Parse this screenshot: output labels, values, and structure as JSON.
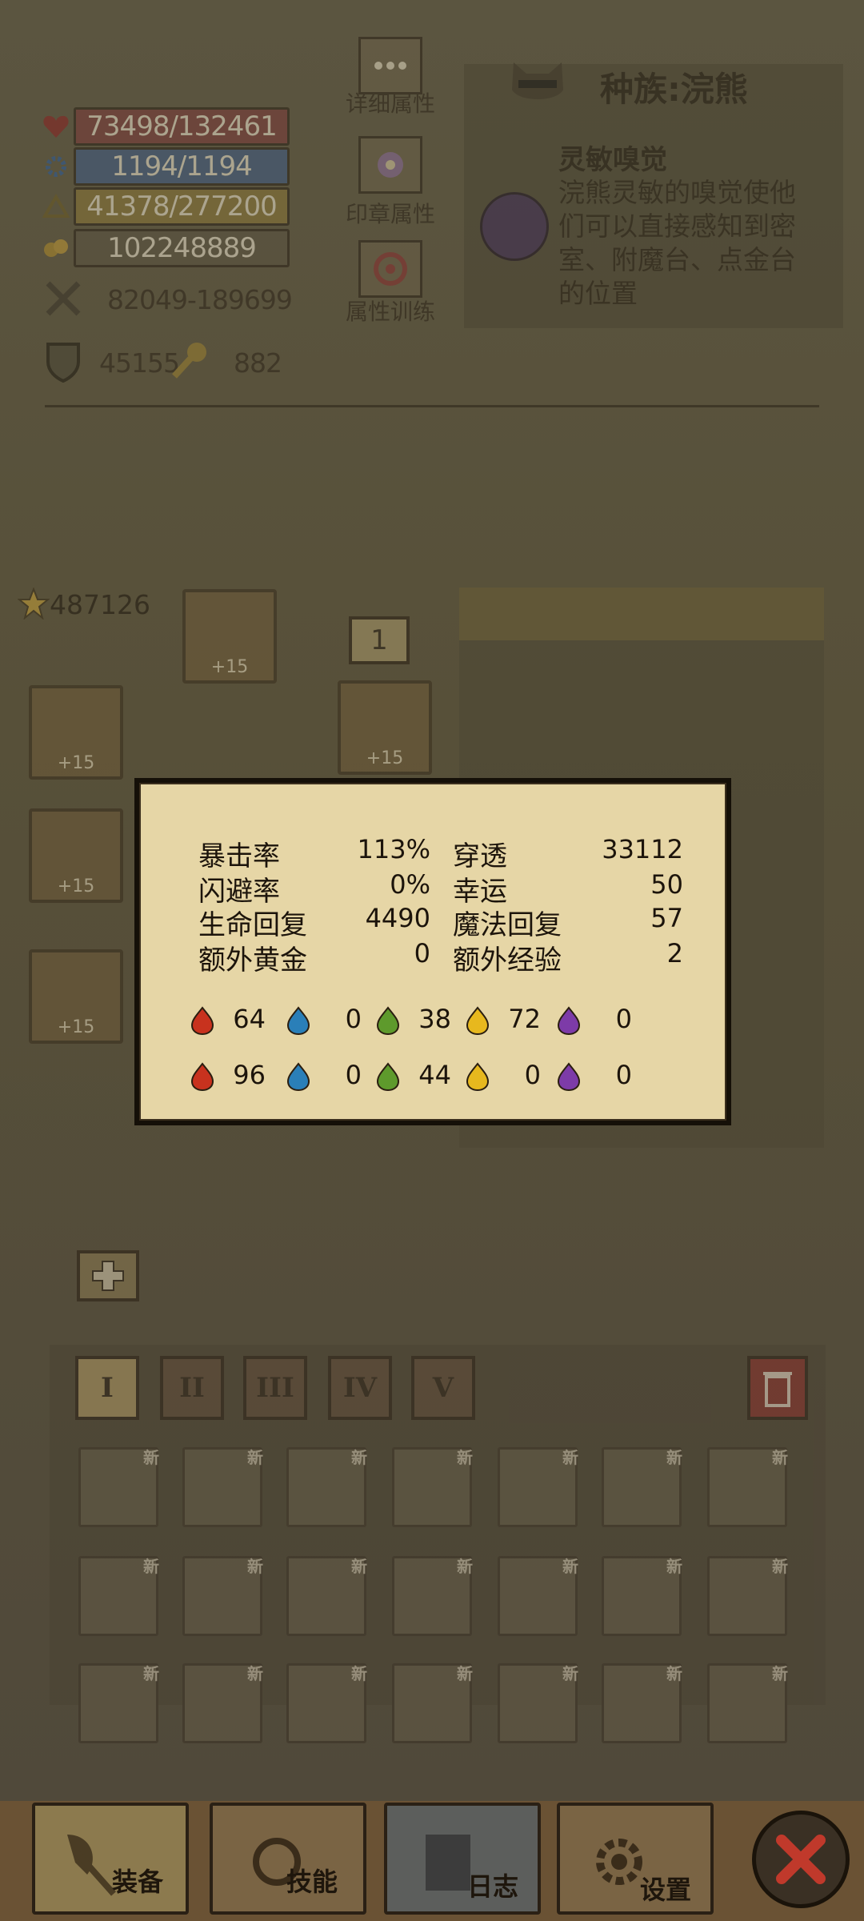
{
  "stats": {
    "hp": "73498/132461",
    "mp": "1194/1194",
    "xp": "41378/277200",
    "gold": "102248889",
    "attack": "82049-189699",
    "defense": "45155",
    "keys": "882"
  },
  "side_buttons": {
    "detail": "详细属性",
    "seal": "印章属性",
    "training": "属性训练"
  },
  "race": {
    "title": "种族:浣熊",
    "skill_name": "灵敏嗅觉",
    "skill_desc_lines": [
      "浣熊灵敏的嗅觉使他",
      "们可以直接感知到密",
      "室、附魔台、点金台",
      "的位置"
    ]
  },
  "score": "487126",
  "level_box": "1",
  "plus15": "+15",
  "popup": {
    "rows": [
      {
        "l1": "暴击率",
        "v1": "113%",
        "l2": "穿透",
        "v2": "33112"
      },
      {
        "l1": "闪避率",
        "v1": "0%",
        "l2": "幸运",
        "v2": "50"
      },
      {
        "l1": "生命回复",
        "v1": "4490",
        "l2": "魔法回复",
        "v2": "57"
      },
      {
        "l1": "额外黄金",
        "v1": "0",
        "l2": "额外经验",
        "v2": "2"
      }
    ],
    "attack_elements": [
      {
        "icon": "fire-attack-icon",
        "color": "#c8321e",
        "value": "64"
      },
      {
        "icon": "water-attack-icon",
        "color": "#2a7fb8",
        "value": "0"
      },
      {
        "icon": "nature-attack-icon",
        "color": "#5e9a2c",
        "value": "38"
      },
      {
        "icon": "light-attack-icon",
        "color": "#e7b81e",
        "value": "72"
      },
      {
        "icon": "dark-attack-icon",
        "color": "#7d3ba8",
        "value": "0"
      }
    ],
    "resist_elements": [
      {
        "icon": "fire-resist-icon",
        "color": "#c8321e",
        "value": "96"
      },
      {
        "icon": "water-resist-icon",
        "color": "#2a7fb8",
        "value": "0"
      },
      {
        "icon": "nature-resist-icon",
        "color": "#5e9a2c",
        "value": "44"
      },
      {
        "icon": "light-resist-icon",
        "color": "#e7b81e",
        "value": "0"
      },
      {
        "icon": "dark-resist-icon",
        "color": "#7d3ba8",
        "value": "0"
      }
    ]
  },
  "tabs": [
    "I",
    "II",
    "III",
    "IV",
    "V"
  ],
  "new_badge": "新",
  "nav": {
    "equip": "装备",
    "skills": "技能",
    "log": "日志",
    "settings": "设置"
  },
  "colors": {
    "hp": "#8a2a2e",
    "mp": "#3b66a8",
    "xp": "#a88a3a",
    "gold": "#58503c",
    "close": "#c0392b"
  }
}
